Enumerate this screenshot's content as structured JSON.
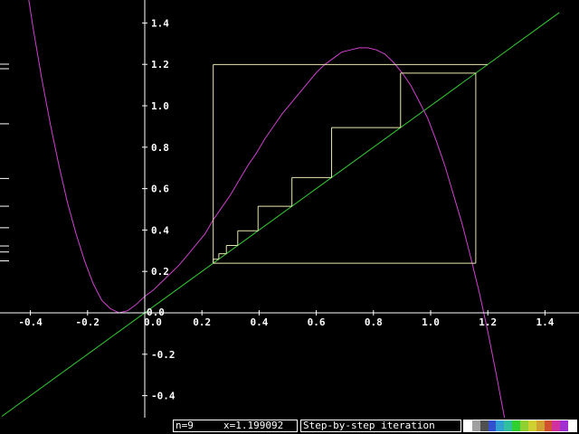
{
  "chart_data": {
    "type": "line",
    "title": "",
    "xlabel": "",
    "ylabel": "",
    "xlim": [
      -0.5,
      1.45
    ],
    "ylim": [
      -0.5,
      1.5
    ],
    "x_ticks": [
      -0.4,
      -0.2,
      0.0,
      0.2,
      0.4,
      0.6,
      0.8,
      1.0,
      1.2,
      1.4
    ],
    "y_ticks": [
      -0.4,
      -0.2,
      0.0,
      0.2,
      0.4,
      0.6,
      0.8,
      1.0,
      1.2,
      1.4
    ],
    "x_tick_labels": [
      "-0.4",
      "-0.2",
      "0.0",
      "0.2",
      "0.4",
      "0.6",
      "0.8",
      "1.0",
      "1.2",
      "1.4"
    ],
    "y_tick_labels": [
      "-0.4",
      "-0.2",
      "0.0",
      "0.2",
      "0.4",
      "0.6",
      "0.8",
      "1.0",
      "1.2",
      "1.4"
    ],
    "origin_label": "0.0",
    "grid": false,
    "colors": {
      "background": "#000000",
      "axes": "#ffffff",
      "curve": "#d040d0",
      "identity": "#30d030",
      "cobweb": "#e8e8b0"
    },
    "series": [
      {
        "type": "curve",
        "x": [
          -0.45,
          -0.42,
          -0.39,
          -0.36,
          -0.33,
          -0.3,
          -0.27,
          -0.24,
          -0.21,
          -0.18,
          -0.15,
          -0.12,
          -0.09,
          -0.06,
          -0.03,
          0.0,
          0.03,
          0.06,
          0.09,
          0.12,
          0.15,
          0.18,
          0.21,
          0.24,
          0.27,
          0.3,
          0.33,
          0.36,
          0.39,
          0.42,
          0.45,
          0.48,
          0.51,
          0.54,
          0.57,
          0.6,
          0.63,
          0.66,
          0.69,
          0.72,
          0.75,
          0.78,
          0.81,
          0.84,
          0.87,
          0.9,
          0.93,
          0.96,
          0.99,
          1.02,
          1.05,
          1.08,
          1.11,
          1.14,
          1.17,
          1.2,
          1.23,
          1.26
        ],
        "y": [
          1.92,
          1.64,
          1.37,
          1.13,
          0.91,
          0.71,
          0.53,
          0.38,
          0.25,
          0.14,
          0.06,
          0.02,
          0.0,
          0.01,
          0.04,
          0.08,
          0.11,
          0.15,
          0.19,
          0.23,
          0.28,
          0.33,
          0.38,
          0.45,
          0.51,
          0.57,
          0.64,
          0.71,
          0.77,
          0.84,
          0.9,
          0.96,
          1.01,
          1.06,
          1.11,
          1.16,
          1.2,
          1.23,
          1.26,
          1.27,
          1.28,
          1.28,
          1.27,
          1.25,
          1.21,
          1.16,
          1.1,
          1.02,
          0.94,
          0.83,
          0.71,
          0.57,
          0.43,
          0.27,
          0.1,
          -0.09,
          -0.3,
          -0.52
        ]
      },
      {
        "type": "identity",
        "x": [
          -0.5,
          1.45
        ],
        "y": [
          -0.5,
          1.45
        ]
      },
      {
        "type": "cobweb",
        "iterates": [
          0.2395,
          0.2591,
          0.2855,
          0.3253,
          0.3963,
          0.5148,
          0.6536,
          0.8949,
          1.1579,
          0.2395,
          1.1991
        ]
      }
    ],
    "left_markers_y": [
      1.201,
      1.179,
      0.913,
      0.649,
      0.515,
      0.411,
      0.323,
      0.294,
      0.251
    ]
  },
  "status": {
    "iteration_label": "n=9",
    "x_readout": "x=1.199092",
    "mode_label": "Step-by-step iteration"
  },
  "palette": [
    "#ffffff",
    "#a0a0a0",
    "#505050",
    "#3050d0",
    "#30a0d0",
    "#30c0a0",
    "#30d030",
    "#90d030",
    "#d0d030",
    "#d0a030",
    "#d05030",
    "#d030a0",
    "#a030d0",
    "#ffffff"
  ]
}
